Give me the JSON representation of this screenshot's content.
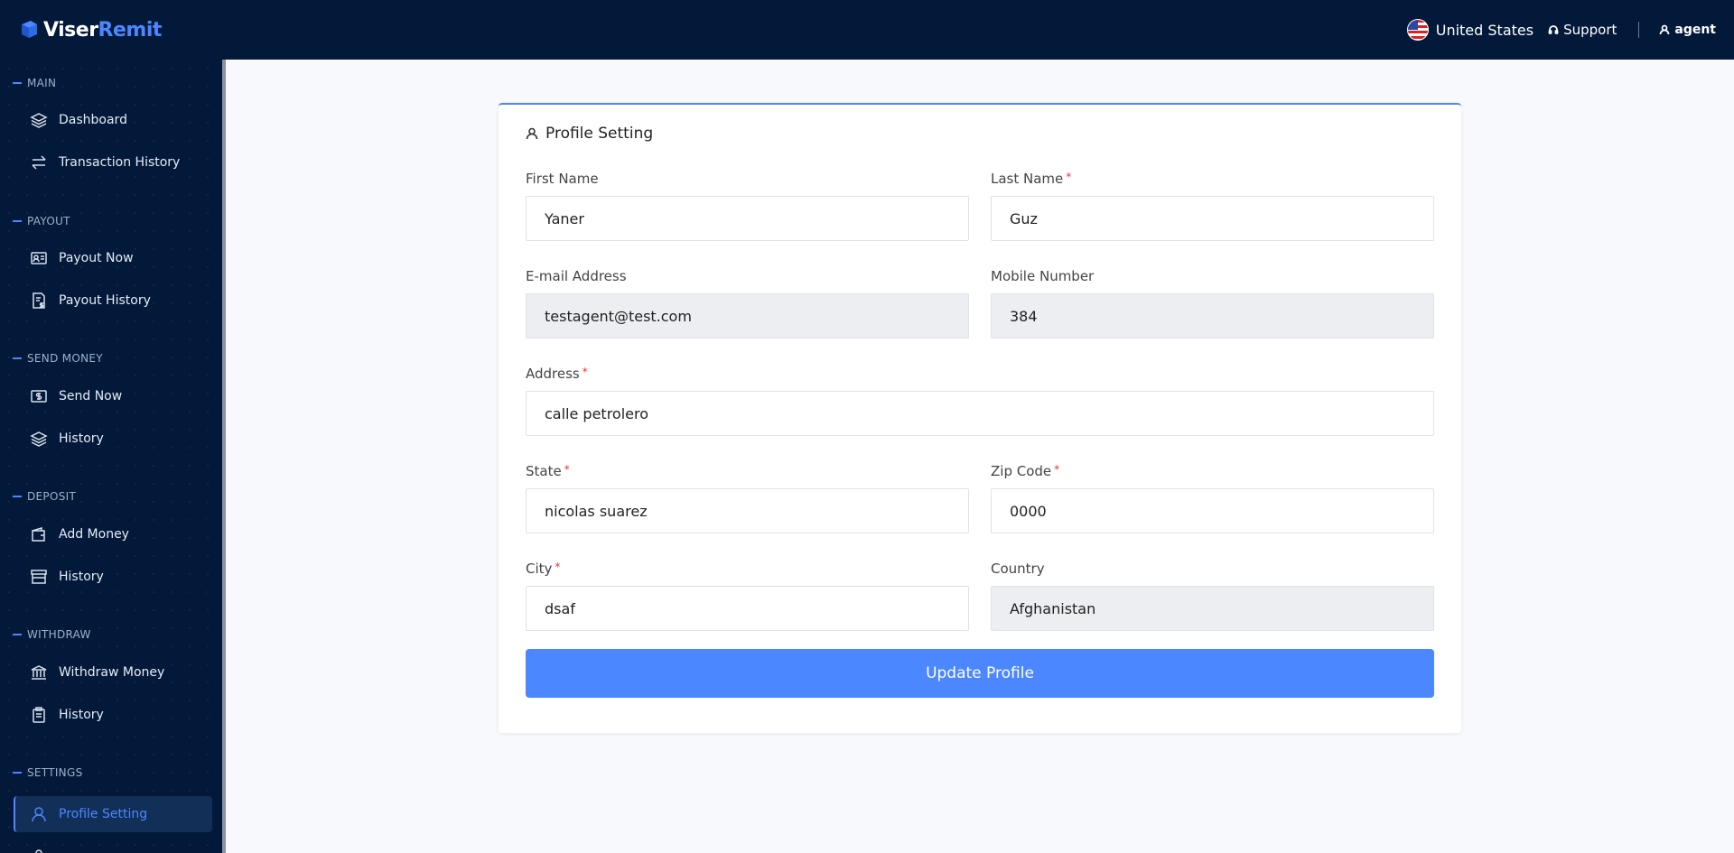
{
  "header": {
    "logo": {
      "part1": "Viser",
      "part2": "Remit"
    },
    "country": "United States",
    "support": "Support",
    "user": "agent"
  },
  "sidebar": {
    "sections": {
      "main": "MAIN",
      "payout": "PAYOUT",
      "send_money": "SEND MONEY",
      "deposit": "DEPOSIT",
      "withdraw": "WITHDRAW",
      "settings": "SETTINGS"
    },
    "items": {
      "dashboard": "Dashboard",
      "transaction_history": "Transaction History",
      "payout_now": "Payout Now",
      "payout_history": "Payout History",
      "send_now": "Send Now",
      "send_history": "History",
      "add_money": "Add Money",
      "deposit_history": "History",
      "withdraw_money": "Withdraw Money",
      "withdraw_history": "History",
      "profile_setting": "Profile Setting"
    }
  },
  "form": {
    "title": "Profile Setting",
    "fields": {
      "first_name": {
        "label": "First Name",
        "value": "Yaner"
      },
      "last_name": {
        "label": "Last Name",
        "value": "Guz",
        "required": "*"
      },
      "email": {
        "label": "E-mail Address",
        "value": "testagent@test.com"
      },
      "mobile": {
        "label": "Mobile Number",
        "value": "384"
      },
      "address": {
        "label": "Address",
        "value": "calle petrolero",
        "required": "*"
      },
      "state": {
        "label": "State",
        "value": "nicolas suarez",
        "required": "*"
      },
      "zip": {
        "label": "Zip Code",
        "value": "0000",
        "required": "*"
      },
      "city": {
        "label": "City",
        "value": "dsaf",
        "required": "*"
      },
      "country": {
        "label": "Country",
        "value": "Afghanistan"
      }
    },
    "submit_label": "Update Profile"
  },
  "colors": {
    "navy": "#02193a",
    "accent": "#4b87ff",
    "required": "#ee3333"
  }
}
